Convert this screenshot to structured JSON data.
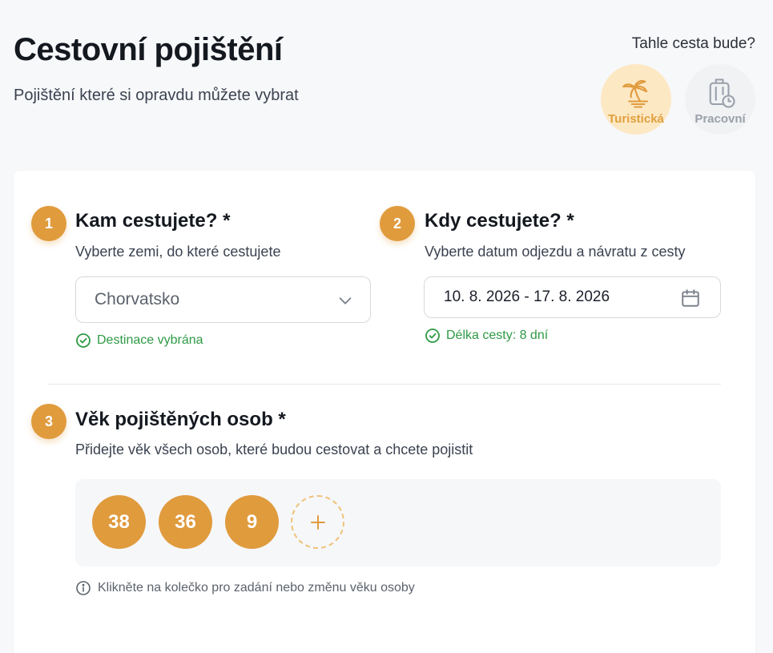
{
  "header": {
    "title": "Cestovní pojištění",
    "subtitle": "Pojištění které si opravdu můžete vybrat"
  },
  "trip_type": {
    "question": "Tahle cesta bude?",
    "options": [
      {
        "label": "Turistická",
        "icon": "palm-beach-icon",
        "selected": true
      },
      {
        "label": "Pracovní",
        "icon": "luggage-clock-icon",
        "selected": false
      }
    ]
  },
  "steps": {
    "destination": {
      "number": "1",
      "title": "Kam cestujete? *",
      "description": "Vyberte zemi, do které cestujete",
      "value": "Chorvatsko",
      "status": "Destinace vybrána"
    },
    "dates": {
      "number": "2",
      "title": "Kdy cestujete? *",
      "description": "Vyberte datum odjezdu a návratu z cesty",
      "value": "10. 8. 2026 - 17. 8. 2026",
      "status": "Délka cesty: 8 dní"
    },
    "ages": {
      "number": "3",
      "title": "Věk pojištěných osob *",
      "description": "Přidejte věk všech osob, které budou cestovat a chcete pojistit",
      "values": [
        "38",
        "36",
        "9"
      ],
      "hint": "Klikněte na kolečko pro zadání nebo změnu věku osoby"
    }
  },
  "colors": {
    "accent": "#e09b3d",
    "accent_light": "#fde8c4",
    "success": "#2e9a45"
  }
}
